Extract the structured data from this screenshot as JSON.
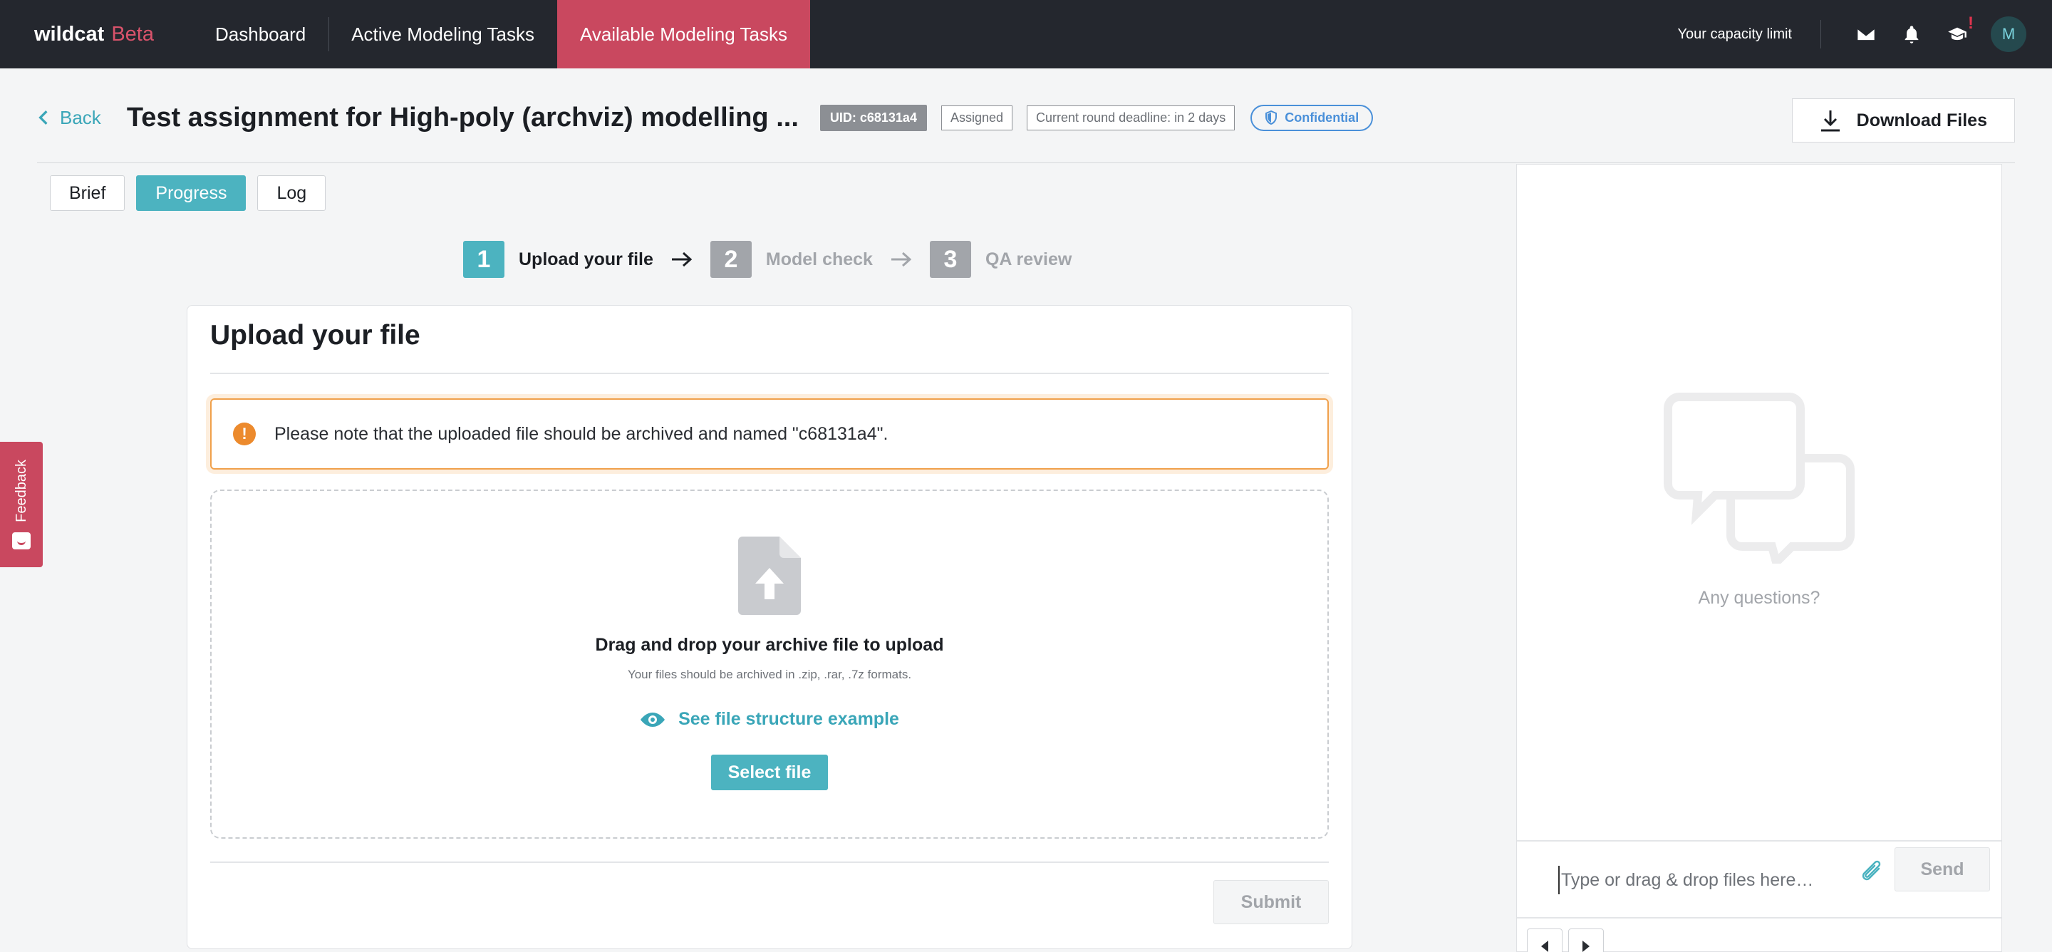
{
  "brand": {
    "name": "wildcat",
    "tag": "Beta"
  },
  "nav": {
    "links": [
      {
        "label": "Dashboard"
      },
      {
        "label": "Active Modeling Tasks"
      },
      {
        "label": "Available Modeling Tasks"
      }
    ],
    "capacity_label": "Your capacity limit",
    "alert_mark": "!",
    "avatar_initial": "M"
  },
  "header": {
    "back_label": "Back",
    "title": "Test assignment for High-poly (archviz) modelling ...",
    "uid": "UID: c68131a4",
    "status": "Assigned",
    "deadline": "Current round deadline: in 2 days",
    "confidential": "Confidential",
    "download_label": "Download Files"
  },
  "tabs": [
    {
      "label": "Brief"
    },
    {
      "label": "Progress"
    },
    {
      "label": "Log"
    }
  ],
  "steps": [
    {
      "number": "1",
      "label": "Upload your file"
    },
    {
      "number": "2",
      "label": "Model check"
    },
    {
      "number": "3",
      "label": "QA review"
    }
  ],
  "upload": {
    "title": "Upload your file",
    "notice": "Please note that the uploaded file should be archived and named \"c68131a4\".",
    "warn_mark": "!",
    "drop_title": "Drag and drop your archive file to upload",
    "drop_sub": "Your files should be archived in .zip, .rar, .7z formats.",
    "example_link": "See file structure example",
    "select_label": "Select file",
    "submit_label": "Submit"
  },
  "feedback": {
    "label": "Feedback"
  },
  "chat": {
    "empty_text": "Any questions?",
    "input_placeholder": "Type or drag & drop files here…",
    "send_label": "Send"
  },
  "colors": {
    "nav_bg": "#24272e",
    "brand_accent": "#c9485f",
    "teal_accent": "#4cb3c0",
    "warning": "#ec8a2d",
    "confidential": "#4a90d9"
  }
}
